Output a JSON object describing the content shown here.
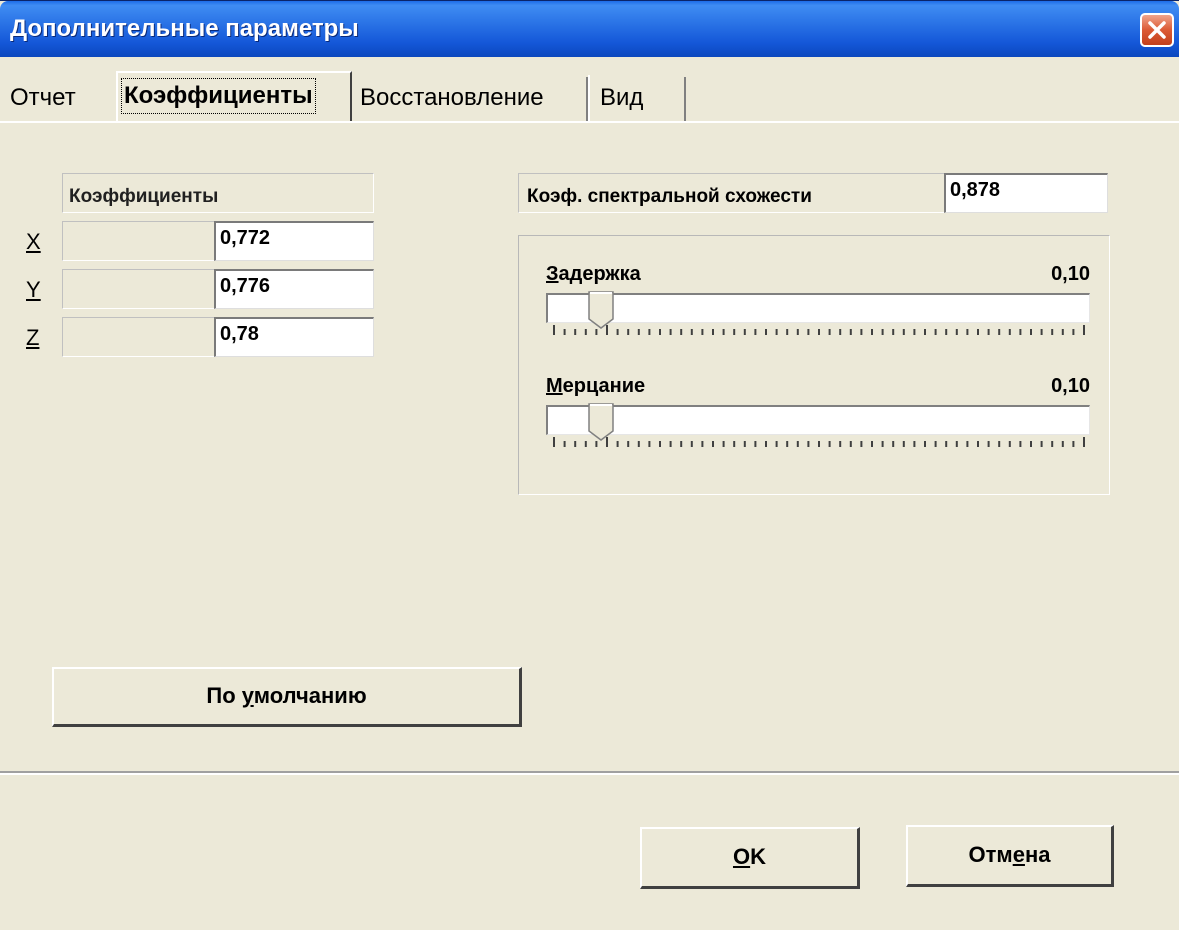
{
  "window": {
    "title": "Дополнительные параметры"
  },
  "tabs": [
    {
      "label": "Отчет"
    },
    {
      "label": "Коэффициенты"
    },
    {
      "label": "Восстановление"
    },
    {
      "label": "Вид"
    }
  ],
  "active_tab": "Коэффициенты",
  "coefficients": {
    "header": "Коэффициенты",
    "rows": [
      {
        "axis": "X",
        "value": "0,772"
      },
      {
        "axis": "Y",
        "value": "0,776"
      },
      {
        "axis": "Z",
        "value": "0,78"
      }
    ]
  },
  "spectral": {
    "label": "Коэф. спектральной схожести",
    "value": "0,878"
  },
  "sliders": [
    {
      "label_accel": "З",
      "label_rest": "адержка",
      "value_text": "0,10",
      "position": 0.1
    },
    {
      "label_accel": "М",
      "label_rest": "ерцание",
      "value_text": "0,10",
      "position": 0.1
    }
  ],
  "buttons": {
    "default_prefix": "По ",
    "default_accel": "у",
    "default_rest": "молчанию",
    "ok_accel": "O",
    "ok_rest": "K",
    "cancel_prefix": "Отм",
    "cancel_accel": "е",
    "cancel_rest": "на"
  },
  "colors": {
    "title_bar": "#2a73e6",
    "dialog_bg": "#ece9d8",
    "close_button": "#dc5a34"
  }
}
